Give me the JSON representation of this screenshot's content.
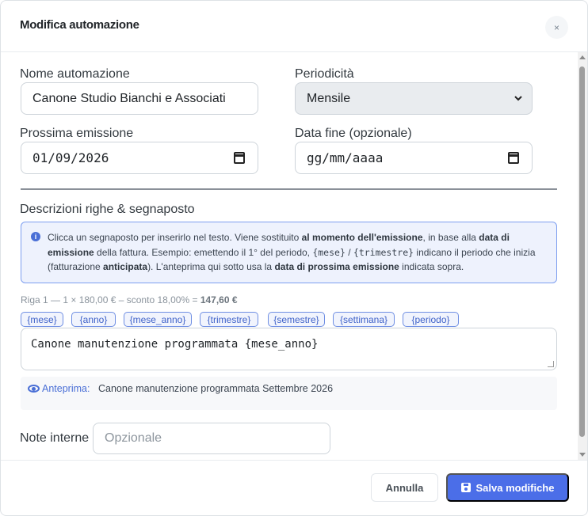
{
  "modal": {
    "title": "Modifica automazione",
    "close_icon": "×"
  },
  "fields": {
    "name_label": "Nome automazione",
    "name_value": "Canone Studio Bianchi e Associati",
    "periodicity_label": "Periodicità",
    "periodicity_value": "Mensile",
    "next_emission_label": "Prossima emissione",
    "next_emission_value": "01/09/2026",
    "end_date_label": "Data fine (opzionale)",
    "end_date_placeholder": "gg/mm/aaaa"
  },
  "section": {
    "title": "Descrizioni righe & segnaposto"
  },
  "info": {
    "icon": "info-icon",
    "p1": "Clicca un segnaposto per inserirlo nel testo. Viene sostituito ",
    "b1": "al momento dell'emissione",
    "p2": ", in base alla ",
    "b2": "data di emissione",
    "p3": " della fattura. Esempio: emettendo il 1° del periodo, ",
    "c1": "{mese}",
    "p4": " / ",
    "c2": "{trimestre}",
    "p5": " indicano il periodo che inizia (fatturazione ",
    "b3": "anticipata",
    "p6": "). L'anteprima qui sotto usa la ",
    "b4": "data di prossima emissione",
    "p7": " indicata sopra."
  },
  "line": {
    "meta_prefix": "Riga 1 — 1 × 180,00 € – sconto 18,00% = ",
    "meta_total": "147,60 €",
    "placeholders": [
      "{mese}",
      "{anno}",
      "{mese_anno}",
      "{trimestre}",
      "{semestre}",
      "{settimana}",
      "{periodo}"
    ],
    "description": "Canone manutenzione programmata {mese_anno}",
    "preview_label": "Anteprima:",
    "preview_text": "Canone manutenzione programmata Settembre 2026"
  },
  "notes": {
    "label": "Note interne",
    "placeholder": "Opzionale"
  },
  "footer": {
    "cancel_label": "Annulla",
    "save_label": "Salva modifiche"
  },
  "colors": {
    "accent": "#4b6ee8",
    "info_bg": "#eef2fd",
    "info_border": "#7d9ef0",
    "chip_text": "#3f62c9"
  }
}
